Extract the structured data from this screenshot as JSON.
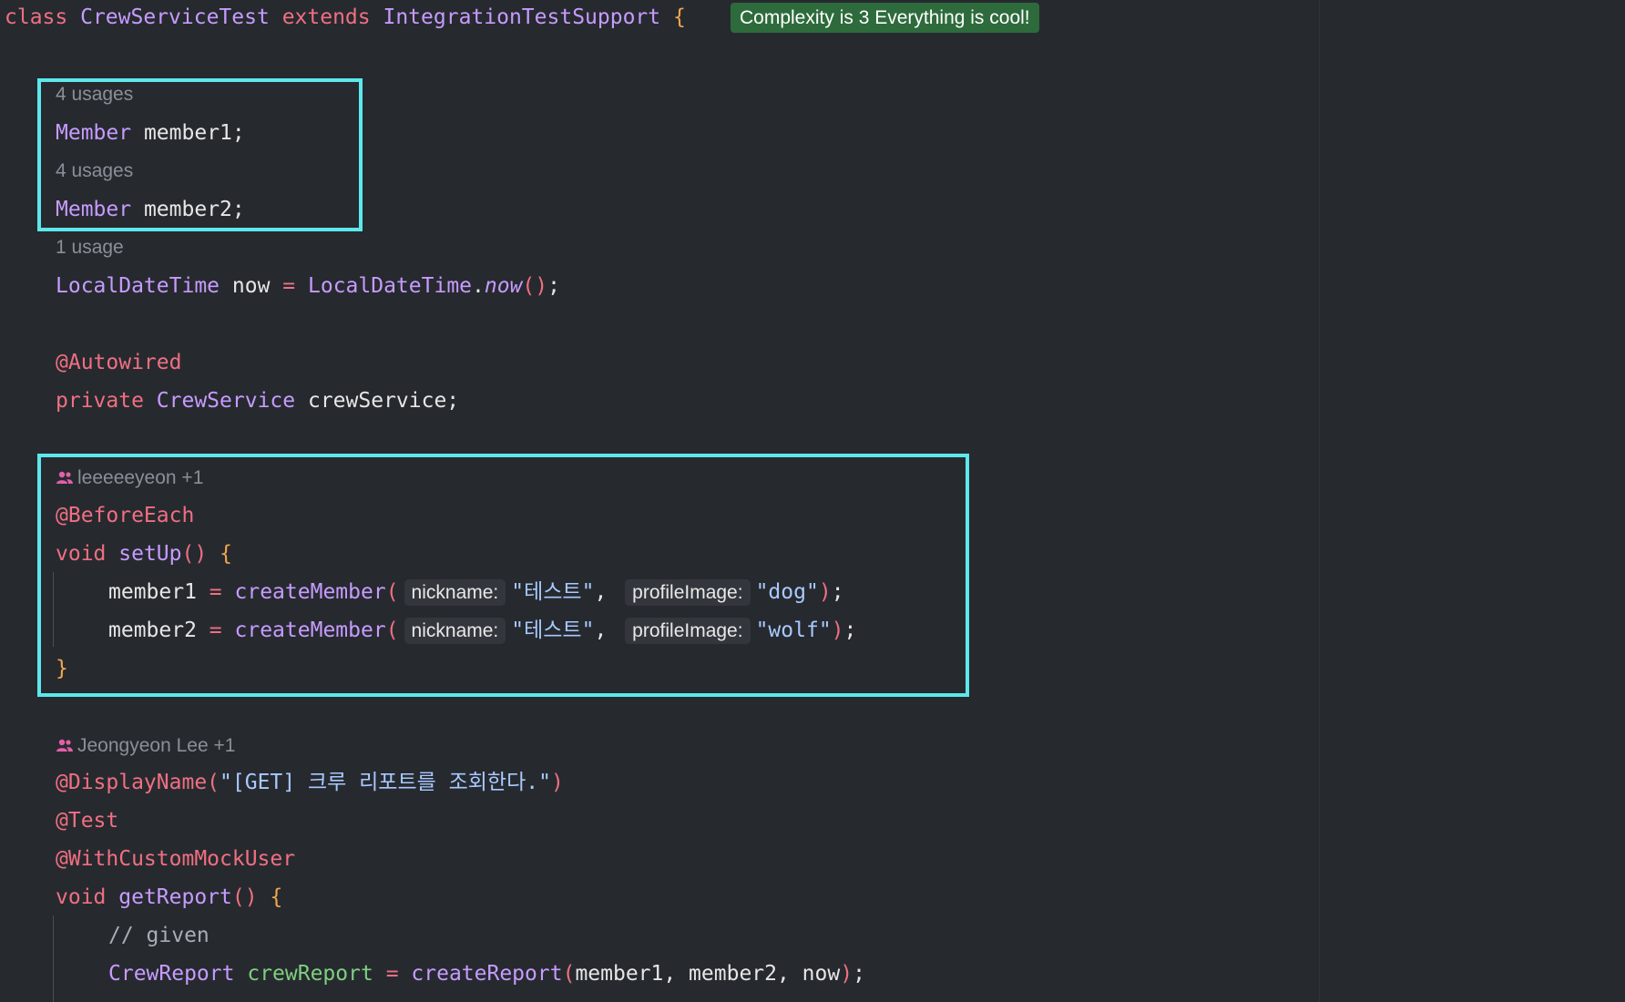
{
  "header": {
    "class_kw": "class",
    "class_name": "CrewServiceTest",
    "extends_kw": "extends",
    "super_name": "IntegrationTestSupport",
    "open_brace": "{",
    "complexity_badge": "Complexity is 3 Everything is cool!"
  },
  "fields": {
    "usage1": "4 usages",
    "member1_type": "Member",
    "member1_name": "member1;",
    "usage2": "4 usages",
    "member2_type": "Member",
    "member2_name": "member2;",
    "usage3": "1 usage",
    "now_type": "LocalDateTime",
    "now_decl": "now",
    "now_eq": "=",
    "now_class": "LocalDateTime",
    "now_dot": ".",
    "now_call": "now",
    "now_parens": "()",
    "now_semi": ";"
  },
  "autowired": {
    "annotation": "@Autowired",
    "private_kw": "private",
    "type": "CrewService",
    "name": "crewService;"
  },
  "setup": {
    "author": "leeeeeyeon +1",
    "annotation": "@BeforeEach",
    "void_kw": "void",
    "method_name": "setUp",
    "parens": "()",
    "open_brace": "{",
    "line1_var": "member1",
    "line1_eq": "=",
    "line1_fn": "createMember",
    "line1_open": "(",
    "line1_hint1": "nickname:",
    "line1_arg1": "\"테스트\"",
    "line1_comma": ",",
    "line1_hint2": "profileImage:",
    "line1_arg2": "\"dog\"",
    "line1_close": ")",
    "line1_semi": ";",
    "line2_var": "member2",
    "line2_eq": "=",
    "line2_fn": "createMember",
    "line2_open": "(",
    "line2_hint1": "nickname:",
    "line2_arg1": "\"테스트\"",
    "line2_comma": ",",
    "line2_hint2": "profileImage:",
    "line2_arg2": "\"wolf\"",
    "line2_close": ")",
    "line2_semi": ";",
    "close_brace": "}"
  },
  "report_test": {
    "author": "Jeongyeon Lee +1",
    "display_ann": "@DisplayName",
    "display_open": "(",
    "display_str": "\"[GET] 크루 리포트를 조회한다.\"",
    "display_close": ")",
    "test_ann": "@Test",
    "mock_ann": "@WithCustomMockUser",
    "void_kw": "void",
    "method_name": "getReport",
    "parens": "()",
    "open_brace": "{",
    "comment": "// given",
    "report_type": "CrewReport",
    "report_var": "crewReport",
    "report_eq": "=",
    "report_fn": "createReport",
    "report_open": "(",
    "report_args": "member1, member2, now",
    "report_close": ")",
    "report_semi": ";"
  },
  "colors": {
    "background": "#262a2f",
    "highlight_box": "#5ce8ec",
    "badge_bg": "#2e6b3c",
    "keyword": "#f06f81",
    "type": "#c79bff",
    "string": "#a9c9ff"
  }
}
